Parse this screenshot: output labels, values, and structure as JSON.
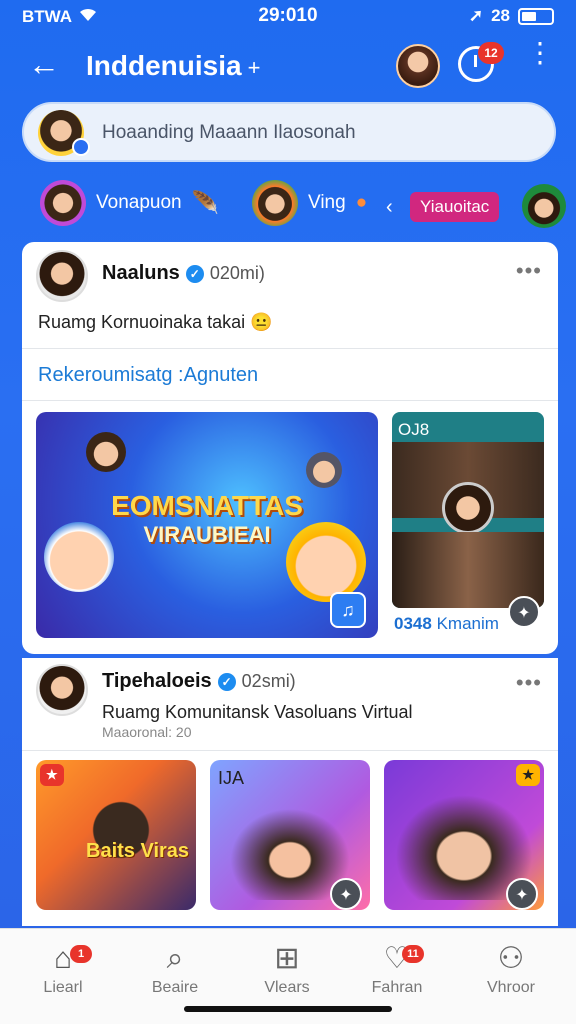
{
  "status_bar": {
    "carrier": "BTWA",
    "time": "29:010",
    "signal_text": "28"
  },
  "app_bar": {
    "title": "Inddenuisia",
    "title_suffix": "+",
    "notification_count": "12"
  },
  "search": {
    "placeholder": "Hoaanding Maaann Ilaosonah"
  },
  "stories": [
    {
      "label": "Vonapuon"
    },
    {
      "label": "Ving"
    },
    {
      "label": "Yiauoitac"
    }
  ],
  "posts": [
    {
      "author": "Naaluns",
      "time": "020mi)",
      "text": "Ruamg Kornuoinaka takai",
      "emoji": "😐",
      "recommend": "Rekeroumisatg :Agnuten",
      "media_headline_1": "EOMSNATTAS",
      "media_headline_2": "VIRAUBIEAI",
      "side_top_label": "OJ8",
      "side_label_a": "0348",
      "side_label_b": "Kmanim"
    },
    {
      "author": "Tipehaloeis",
      "time": "02smi)",
      "text": "Ruamg Komunitansk Vasoluans Virtual",
      "sub": "Maaoronal: 20",
      "tile_1_title": "Baits Viras",
      "tile_2_label": "IJA"
    }
  ],
  "bottom_nav": [
    {
      "label": "Liearl",
      "icon": "home-icon",
      "badge": "1"
    },
    {
      "label": "Beaire",
      "icon": "search-icon"
    },
    {
      "label": "Vlears",
      "icon": "add-post-icon"
    },
    {
      "label": "Fahran",
      "icon": "notifications-icon",
      "badge": "11"
    },
    {
      "label": "Vhroor",
      "icon": "profile-icon"
    }
  ],
  "colors": {
    "primary": "#2a6ff2",
    "badge_red": "#e8342b",
    "story_pink": "#d1277f",
    "link_blue": "#1c7bd6"
  }
}
